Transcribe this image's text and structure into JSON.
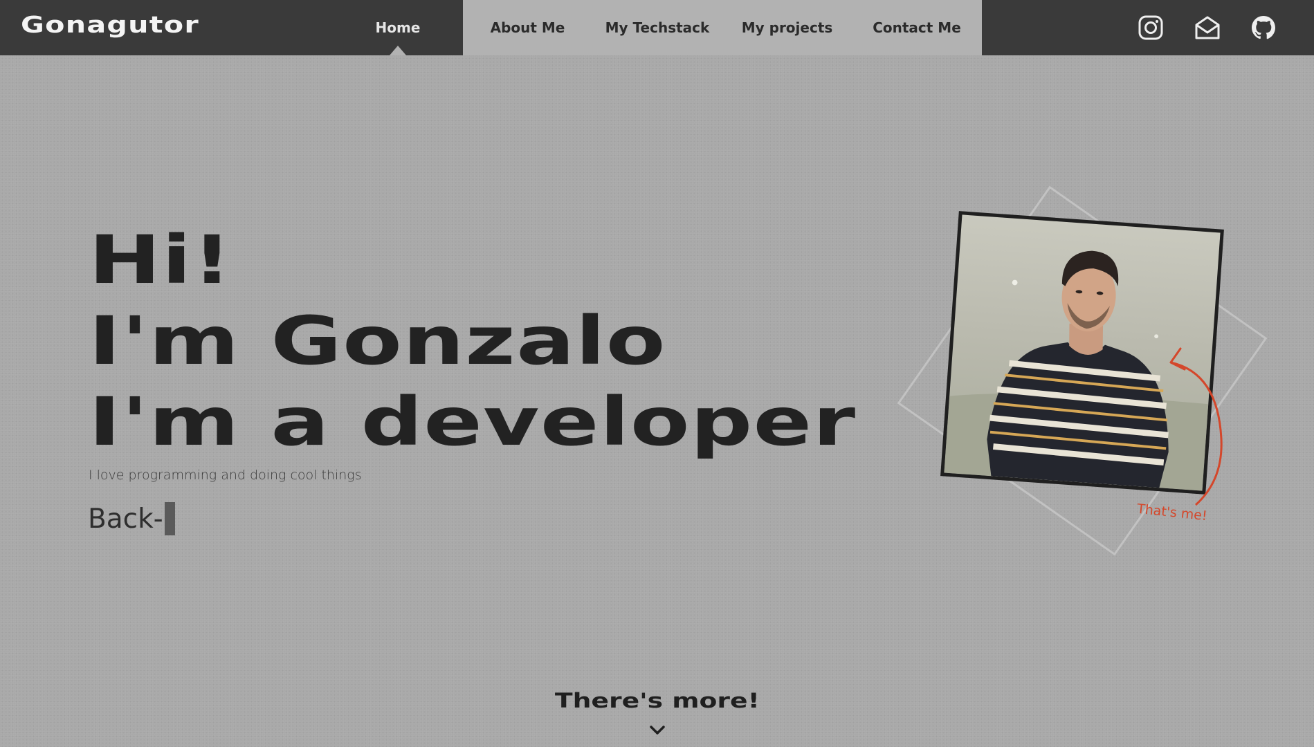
{
  "navbar": {
    "logo": "Gonagutor",
    "items": [
      {
        "label": "Home",
        "active": true
      },
      {
        "label": "About Me",
        "active": false
      },
      {
        "label": "My Techstack",
        "active": false
      },
      {
        "label": "My projects",
        "active": false
      },
      {
        "label": "Contact Me",
        "active": false
      }
    ],
    "social": [
      {
        "icon": "instagram-icon"
      },
      {
        "icon": "mail-icon"
      },
      {
        "icon": "github-icon"
      }
    ]
  },
  "hero": {
    "lines": [
      "Hi!",
      "I'm Gonzalo",
      "I'm a developer"
    ],
    "tagline": "I love programming and doing cool things",
    "typed": "Back-"
  },
  "photo": {
    "caption": "That's me!"
  },
  "footer_cta": {
    "label": "There's more!",
    "icon": "chevron-down-icon"
  },
  "colors": {
    "background": "#a9a9a9",
    "navbar": "#3a3a3a",
    "nav_inactive": "#b2b2b2",
    "accent": "#d4472b"
  }
}
